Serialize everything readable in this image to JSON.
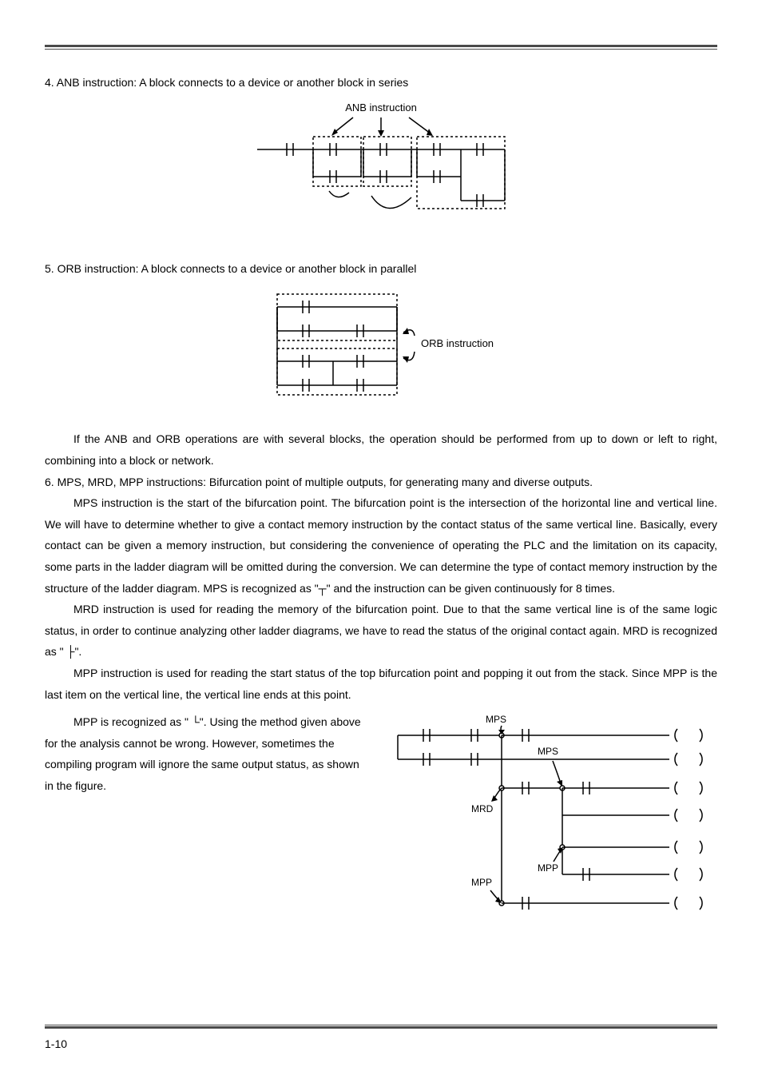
{
  "section4": {
    "heading": "4. ANB instruction: A block connects to a device or another block in series",
    "fig_label": "ANB instruction"
  },
  "section5": {
    "heading": "5. ORB instruction: A block connects to a device or another block in parallel",
    "fig_label": "ORB instruction",
    "para": "If the ANB and ORB operations are with several blocks, the operation should be performed from up to down or left to right, combining into a block or network."
  },
  "section6": {
    "heading": "6. MPS, MRD, MPP instructions: Bifurcation point of multiple outputs, for generating many and diverse outputs.",
    "para_mps": "MPS instruction is the start of the bifurcation point. The bifurcation point is the intersection of the horizontal line and vertical line. We will have to determine whether to give a contact memory instruction by the contact status of the same vertical line. Basically, every contact can be given a memory instruction, but considering the convenience of operating the PLC and the limitation on its capacity, some parts in the ladder diagram will be omitted during the conversion. We can determine the type of contact memory instruction by the structure of the ladder diagram. MPS is recognized as \"┬\" and the instruction can be given continuously for 8 times.",
    "para_mrd": "MRD instruction is used for reading the memory of the bifurcation point. Due to that the same vertical line is of the same logic status, in order to continue analyzing other ladder diagrams, we have to read the status of the original contact again. MRD is recognized as \" ├\".",
    "para_mpp1": "MPP instruction is used for reading the start status of the top bifurcation point and popping it out from the stack. Since MPP is the last item on the vertical line, the vertical line ends at this point.",
    "para_mpp2": "MPP is recognized as \" └\". Using the method given above for the analysis cannot be wrong. However, sometimes the compiling program will ignore the same output status, as shown in the figure.",
    "fig_labels": {
      "mps1": "MPS",
      "mps2": "MPS",
      "mrd": "MRD",
      "mpp_inner": "MPP",
      "mpp_outer": "MPP"
    }
  },
  "footer": {
    "page": "1-10"
  }
}
